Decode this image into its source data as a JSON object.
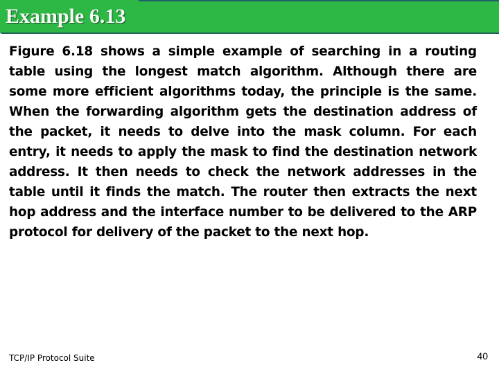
{
  "slide": {
    "title": "Example 6.13",
    "body": "Figure 6.18 shows a simple example of searching in a routing table using the longest match algorithm. Although there are some more efficient algorithms today, the principle is the same. When the forwarding algorithm gets the destination address of the packet, it needs to delve into the mask column. For each entry, it needs to apply the mask to find the destination network address. It then needs to check the network addresses in the table until it finds the match. The router then extracts the next hop address and the interface number to be delivered to the ARP protocol for delivery of the packet to the next hop."
  },
  "footer": {
    "left": "TCP/IP Protocol Suite",
    "page_number": "40"
  },
  "colors": {
    "header_green": "#2db846",
    "header_line": "#1f5e6a"
  }
}
